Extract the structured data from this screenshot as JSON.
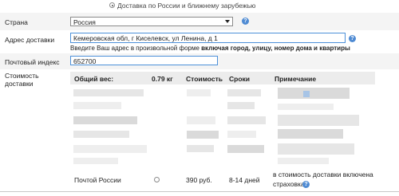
{
  "delivery_option": {
    "label": "Доставка по России и ближнему зарубежью"
  },
  "country": {
    "label": "Страна",
    "value": "Россия"
  },
  "address": {
    "label": "Адрес доставки",
    "value": "Кемеровская обл, г Киселевск, ул Ленина, д 1",
    "hint_prefix": "Введите Ваш адрес в произвольной форме ",
    "hint_bold": "включая город, улицу, номер дома и квартиры"
  },
  "postal": {
    "label": "Почтовый индекс",
    "value": "652700"
  },
  "cost": {
    "label_line1": "Стоимость",
    "label_line2": "доставки",
    "headers": {
      "weight": "Общий вес:",
      "weight_value": "0.79 кг",
      "cost": "Стоимость",
      "terms": "Сроки",
      "note": "Примечание"
    },
    "russian_post": {
      "name": "Почтой России",
      "price": "390 руб.",
      "terms": "8-14 дней",
      "note_line1": "в стоимость доставки включена",
      "note_line2": "страховка"
    }
  },
  "colors": {
    "field_border": "#4c90d9",
    "help_icon": "#4f8bd3",
    "row_bg": "#f4f4f4"
  }
}
